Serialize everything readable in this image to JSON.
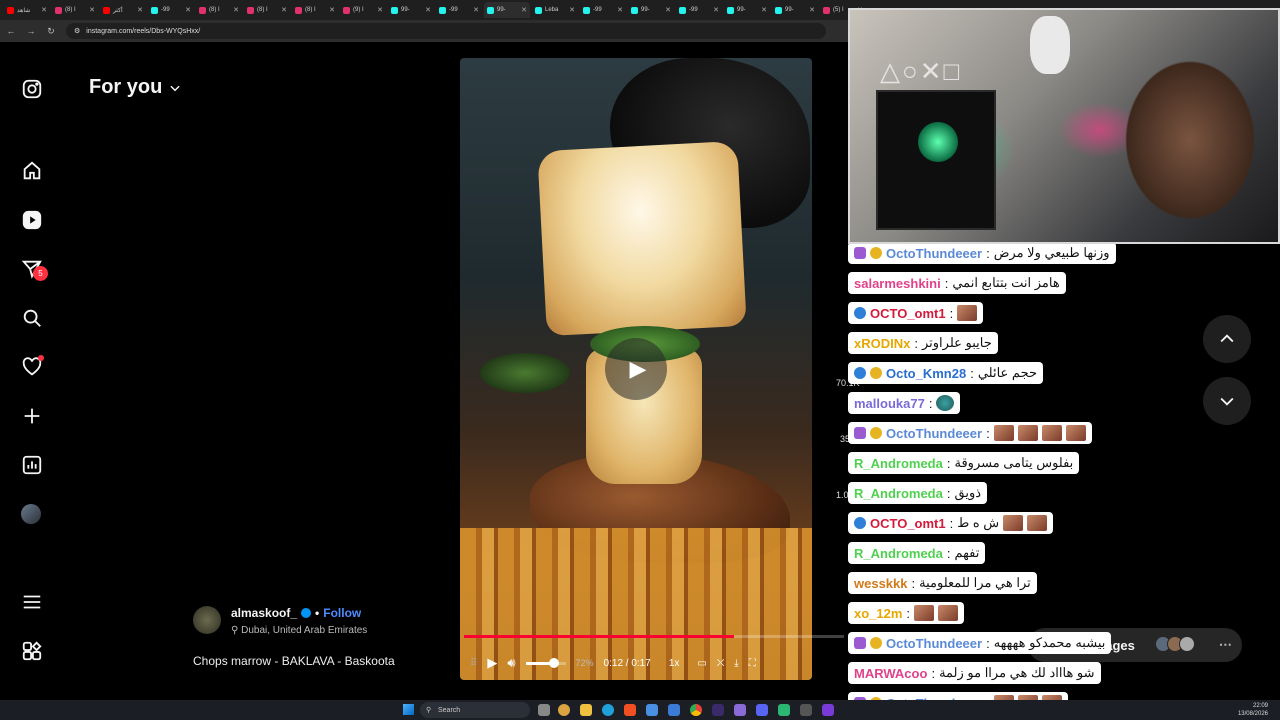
{
  "browser": {
    "tabs": [
      {
        "label": "شاهد",
        "color": "#ff0000"
      },
      {
        "label": "(8) I",
        "color": "#e1306c"
      },
      {
        "label": "أكثر",
        "color": "#ff0000"
      },
      {
        "label": "-99",
        "color": "#25f4ee"
      },
      {
        "label": "(8) I",
        "color": "#e1306c"
      },
      {
        "label": "(8) I",
        "color": "#e1306c"
      },
      {
        "label": "(8) I",
        "color": "#e1306c"
      },
      {
        "label": "(9) I",
        "color": "#e1306c"
      },
      {
        "label": "99-",
        "color": "#25f4ee"
      },
      {
        "label": "-99",
        "color": "#25f4ee"
      },
      {
        "label": "99-",
        "color": "#25f4ee"
      },
      {
        "label": "Leba",
        "color": "#25f4ee"
      },
      {
        "label": "-99",
        "color": "#25f4ee"
      },
      {
        "label": "99-",
        "color": "#25f4ee"
      },
      {
        "label": "-99",
        "color": "#25f4ee"
      },
      {
        "label": "99-",
        "color": "#25f4ee"
      },
      {
        "label": "99-",
        "color": "#25f4ee"
      },
      {
        "label": "(5) I",
        "color": "#e1306c"
      }
    ],
    "tab_close": "✕",
    "url": "instagram.com/reels/Dbs-WYQsHxx/"
  },
  "ig": {
    "feed_title": "For you",
    "notifications_badge": "5",
    "author": {
      "name": "almaskoof_",
      "follow_label": "Follow",
      "separator": "•",
      "location": "Dubai, United Arab Emirates"
    },
    "caption": "Chops marrow - BAKLAVA - Baskoota",
    "player": {
      "progress": 0.71,
      "volume": 0.72,
      "volume_label": "72%",
      "time": "0:12 / 0:17",
      "speed": "1x"
    },
    "action_counts": [
      "70.1K",
      "35",
      "1.0"
    ]
  },
  "chat": {
    "messages": [
      {
        "user": "OctoThundeeer",
        "color": "#5a8ad6",
        "badges": [
          "mod",
          "coin"
        ],
        "text": "وزنها طبيعي ولا مرض",
        "emotes": 0
      },
      {
        "user": "salarmeshkini",
        "color": "#e0428a",
        "badges": [],
        "text": "هامز انت بتتابع انمي",
        "emotes": 0
      },
      {
        "user": "OCTO_omt1",
        "color": "#d41a3a",
        "badges": [
          "globe"
        ],
        "text": "",
        "emotes": 1
      },
      {
        "user": "xRODINx",
        "color": "#e6a700",
        "badges": [],
        "text": "جايبو علراوتر",
        "emotes": 0
      },
      {
        "user": "Octo_Kmn28",
        "color": "#2a6fd0",
        "badges": [
          "globe",
          "coin"
        ],
        "text": "حجم عائلي",
        "emotes": 0
      },
      {
        "user": "mallouka77",
        "color": "#7a6ad8",
        "badges": [],
        "text": "",
        "emotes": 1,
        "dot": true
      },
      {
        "user": "OctoThundeeer",
        "color": "#5a8ad6",
        "badges": [
          "mod",
          "coin"
        ],
        "text": "",
        "emotes": 4
      },
      {
        "user": "R_Andromeda",
        "color": "#4fd04f",
        "badges": [],
        "text": "بفلوس يتامى مسروقة",
        "emotes": 0
      },
      {
        "user": "R_Andromeda",
        "color": "#4fd04f",
        "badges": [],
        "text": "ذويق",
        "emotes": 0
      },
      {
        "user": "OCTO_omt1",
        "color": "#d41a3a",
        "badges": [
          "globe"
        ],
        "text": "ش ه ط",
        "emotes": 2
      },
      {
        "user": "R_Andromeda",
        "color": "#4fd04f",
        "badges": [],
        "text": "تفهم",
        "emotes": 0
      },
      {
        "user": "wesskkk",
        "color": "#d07a1a",
        "badges": [],
        "text": "ترا هي مرا للمعلومية",
        "emotes": 0
      },
      {
        "user": "xo_12m",
        "color": "#e6a700",
        "badges": [],
        "text": "",
        "emotes": 2
      },
      {
        "user": "OctoThundeeer",
        "color": "#5a8ad6",
        "badges": [
          "mod",
          "coin"
        ],
        "text": "بيشبه محمدكو ههههه",
        "emotes": 0
      },
      {
        "user": "MARWAcoo",
        "color": "#e0428a",
        "badges": [],
        "text": "شو هاااد لك هي مراا مو زلمة",
        "emotes": 0
      },
      {
        "user": "OctoThundeeer",
        "color": "#5a8ad6",
        "badges": [
          "mod",
          "coin"
        ],
        "text": "",
        "emotes": 3
      }
    ],
    "separator": ":",
    "messages_pill_label": "sages",
    "messages_pill_more": "⋯"
  },
  "taskbar": {
    "search_placeholder": "Search",
    "time": "22:09",
    "date": "13/08/2026"
  }
}
